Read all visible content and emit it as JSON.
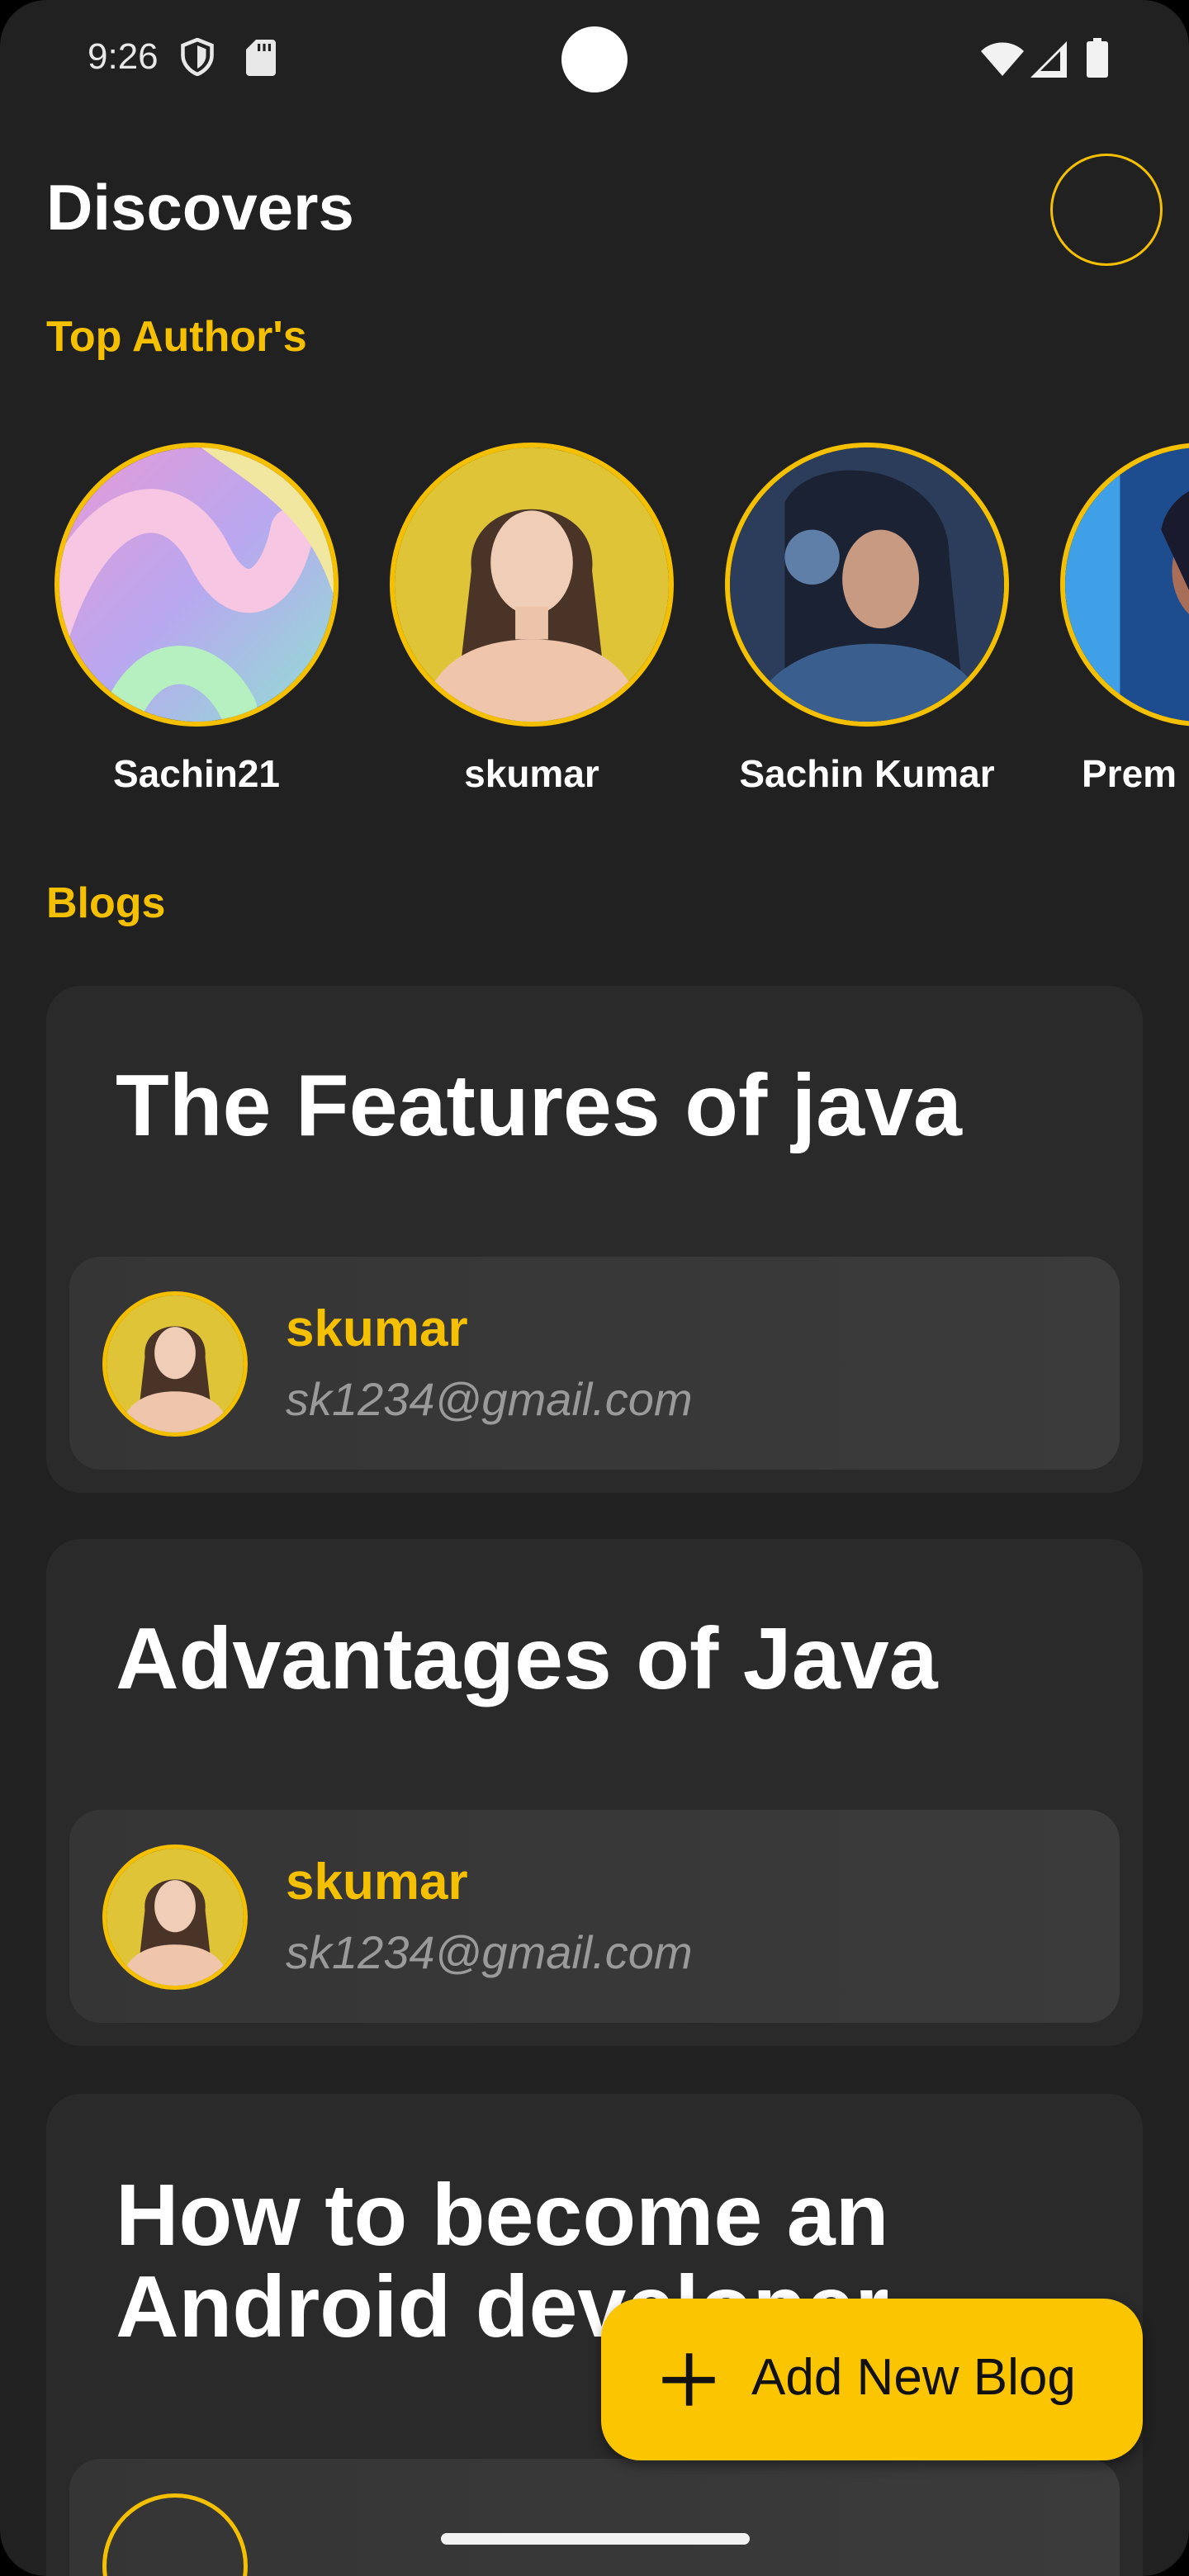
{
  "status_bar": {
    "time": "9:26"
  },
  "header": {
    "title": "Discovers"
  },
  "sections": {
    "top_authors": "Top Author's",
    "blogs": "Blogs"
  },
  "authors": [
    {
      "name": "Sachin21"
    },
    {
      "name": "skumar"
    },
    {
      "name": "Sachin Kumar"
    },
    {
      "name": "Prem"
    }
  ],
  "blogs": [
    {
      "title": "The Features of java",
      "author": "skumar",
      "email": "sk1234@gmail.com"
    },
    {
      "title": "Advantages of Java",
      "author": "skumar",
      "email": "sk1234@gmail.com"
    },
    {
      "title": "How to become an Android developer",
      "author": "",
      "email": ""
    }
  ],
  "fab": {
    "label": "Add New Blog"
  },
  "colors": {
    "accent": "#f5c000",
    "background": "#212121",
    "card": "#2a2a2a"
  }
}
